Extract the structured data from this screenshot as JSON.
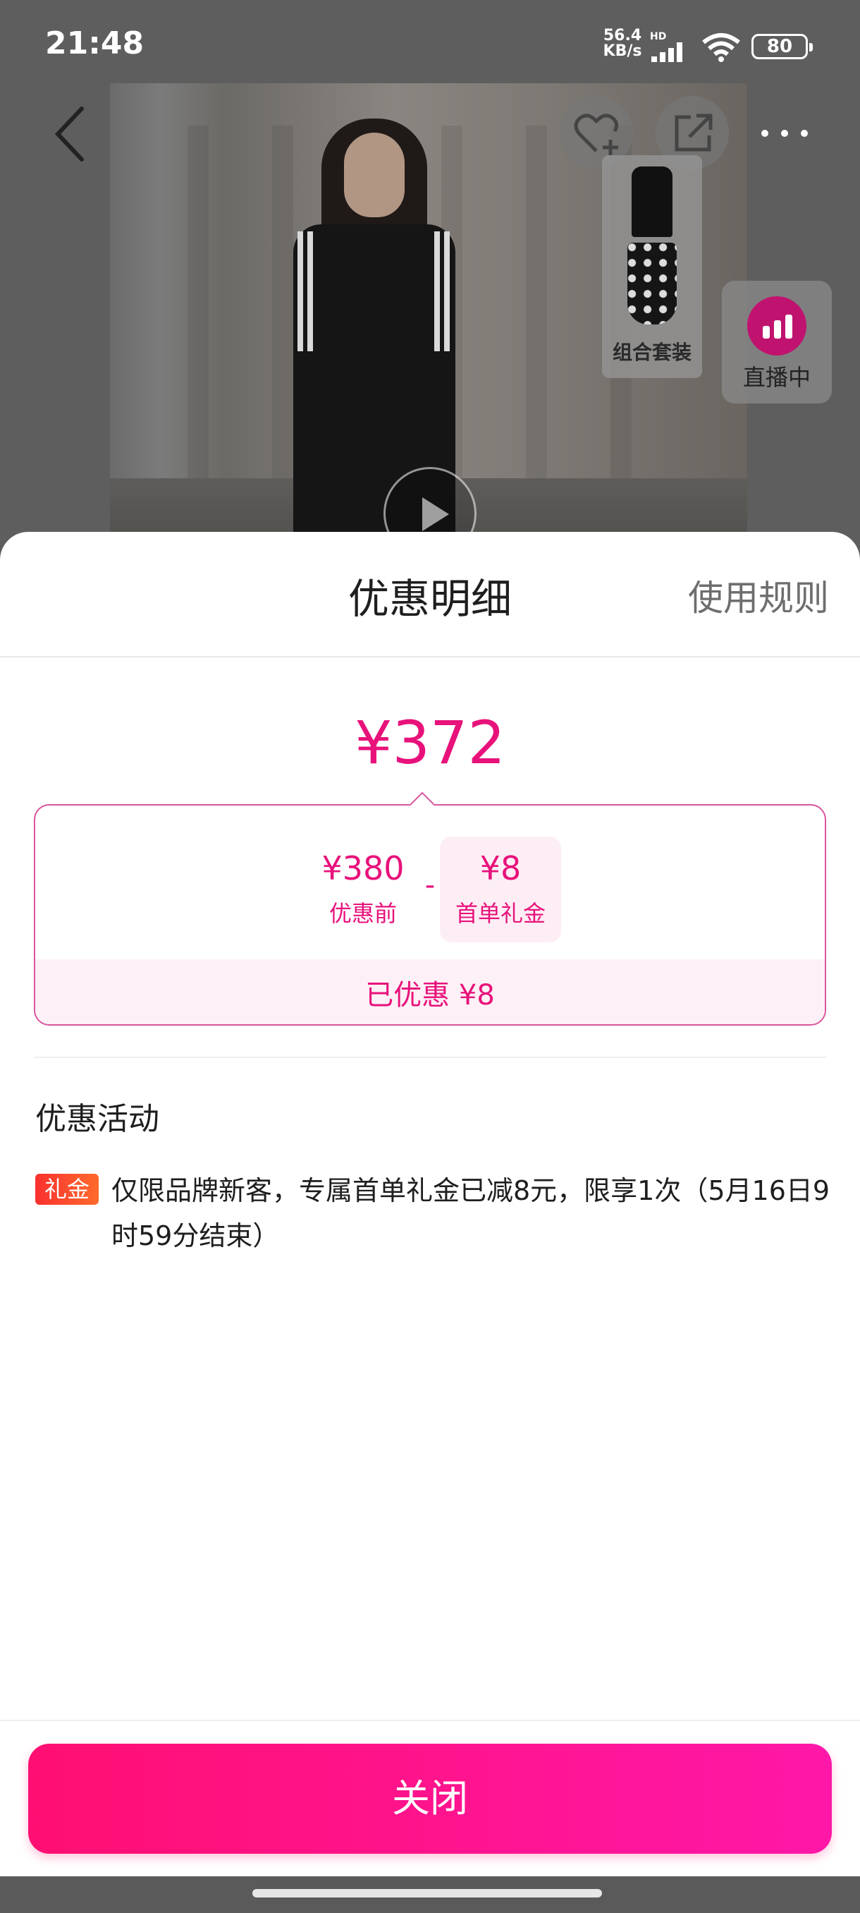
{
  "status_bar": {
    "time": "21:48",
    "net_speed_value": "56.4",
    "net_speed_unit": "KB/s",
    "hd_label": "HD",
    "battery_level": "80",
    "icons": [
      "signal-icon",
      "wifi-icon",
      "battery-icon"
    ]
  },
  "product_header": {
    "combo_label": "组合套装",
    "live_label": "直播中",
    "icons": [
      "back-arrow-icon",
      "favorite-add-icon",
      "share-icon",
      "more-icon",
      "play-icon",
      "live-icon"
    ]
  },
  "sheet": {
    "title": "优惠明细",
    "rules_link": "使用规则",
    "final_price": "¥372",
    "breakdown": {
      "original_price": "¥380",
      "original_label": "优惠前",
      "minus": "-",
      "discount_amount": "¥8",
      "discount_label": "首单礼金",
      "saved_text": "已优惠 ¥8"
    },
    "promotions_heading": "优惠活动",
    "promotions": [
      {
        "badge": "礼金",
        "text": "仅限品牌新客，专属首单礼金已减8元，限享1次（5月16日9时59分结束）"
      }
    ],
    "close_label": "关闭"
  },
  "colors": {
    "accent": "#e8127b",
    "button_gradient_start": "#ff0f72",
    "button_gradient_end": "#ff18a8",
    "badge": "#f9312f",
    "live": "#c0136f"
  }
}
